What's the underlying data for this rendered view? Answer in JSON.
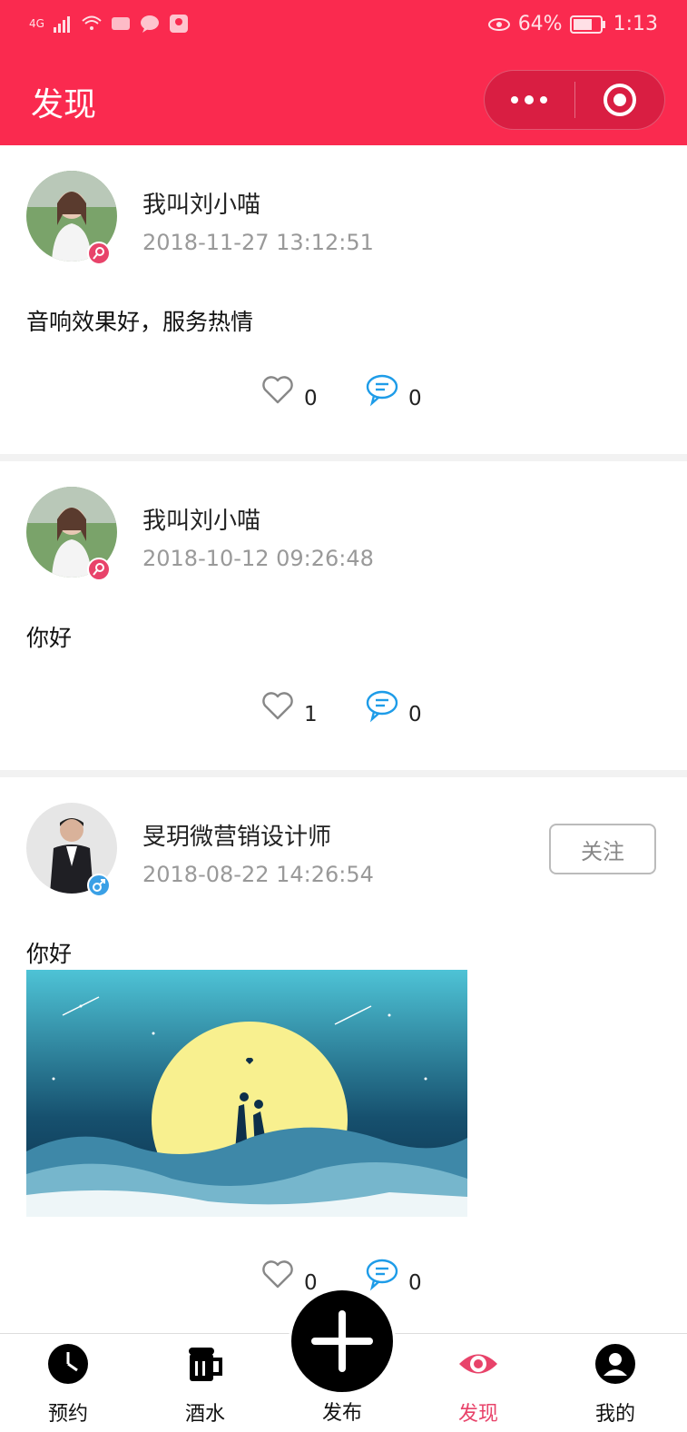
{
  "status_bar": {
    "network": "4G",
    "battery_percent": "64%",
    "time": "1:13"
  },
  "nav": {
    "title": "发现"
  },
  "colors": {
    "brand": "#fa2a4f",
    "female": "#e8436a",
    "male": "#3aa0e6",
    "comment": "#1e9ce8"
  },
  "posts": [
    {
      "username": "我叫刘小喵",
      "time": "2018-11-27 13:12:51",
      "content": "音响效果好，服务热情",
      "likes": "0",
      "comments": "0",
      "gender": "female"
    },
    {
      "username": "我叫刘小喵",
      "time": "2018-10-12 09:26:48",
      "content": "你好",
      "likes": "1",
      "comments": "0",
      "gender": "female"
    },
    {
      "username": "旻玥微营销设计师",
      "time": "2018-08-22 14:26:54",
      "content": "你好",
      "likes": "0",
      "comments": "0",
      "gender": "male",
      "follow_label": "关注"
    }
  ],
  "tabbar": {
    "items": [
      {
        "label": "预约",
        "icon": "clock-icon"
      },
      {
        "label": "酒水",
        "icon": "beer-icon"
      },
      {
        "label": "发布",
        "icon": "plus-icon"
      },
      {
        "label": "发现",
        "icon": "eye-icon",
        "active": true
      },
      {
        "label": "我的",
        "icon": "user-icon"
      }
    ]
  }
}
